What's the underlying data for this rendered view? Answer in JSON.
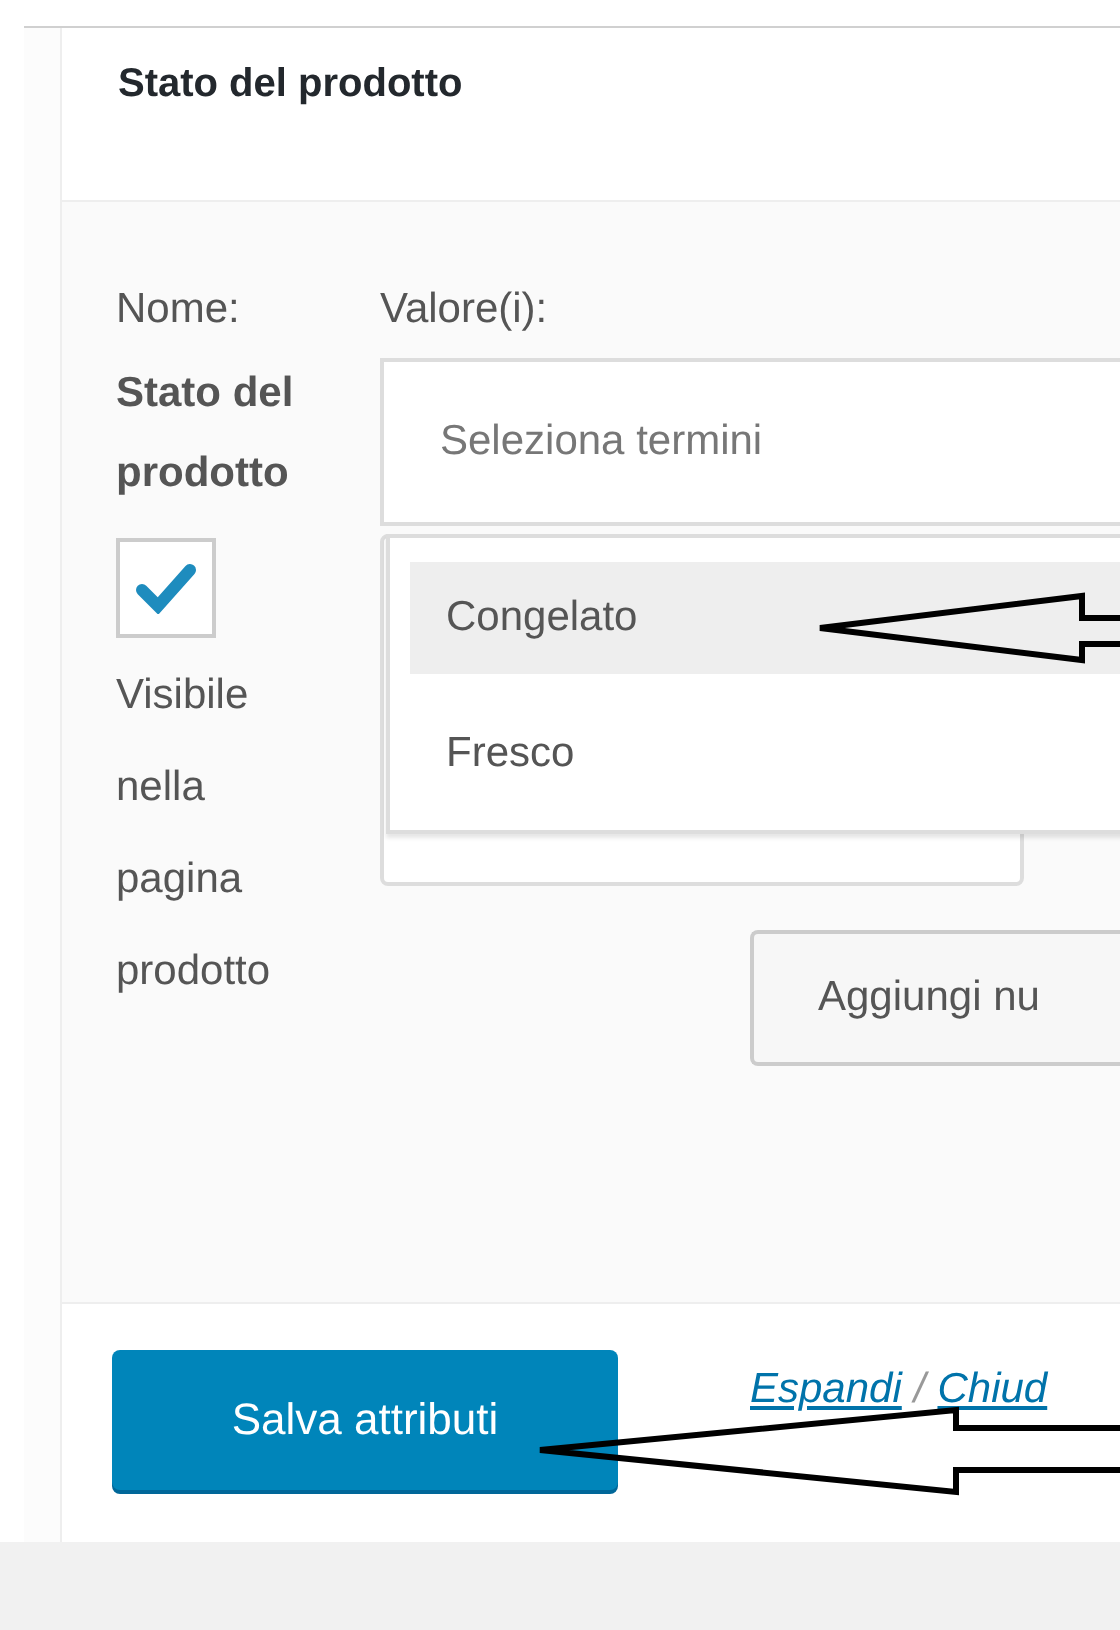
{
  "panel": {
    "title": "Stato del prodotto"
  },
  "attribute": {
    "name_label": "Nome:",
    "values_label": "Valore(i):",
    "name": "Stato del prodotto",
    "visible": {
      "checked": true,
      "label": "Visibile nella pagina prodotto"
    }
  },
  "select": {
    "placeholder": "Seleziona termini"
  },
  "dropdown": [
    {
      "label": "Congelato",
      "selected": true
    },
    {
      "label": "Fresco",
      "selected": false
    }
  ],
  "add_button": "Aggiungi nu",
  "footer": {
    "save_button": "Salva attributi",
    "links": [
      "Espandi",
      "Chiud"
    ],
    "separator": "/"
  }
}
